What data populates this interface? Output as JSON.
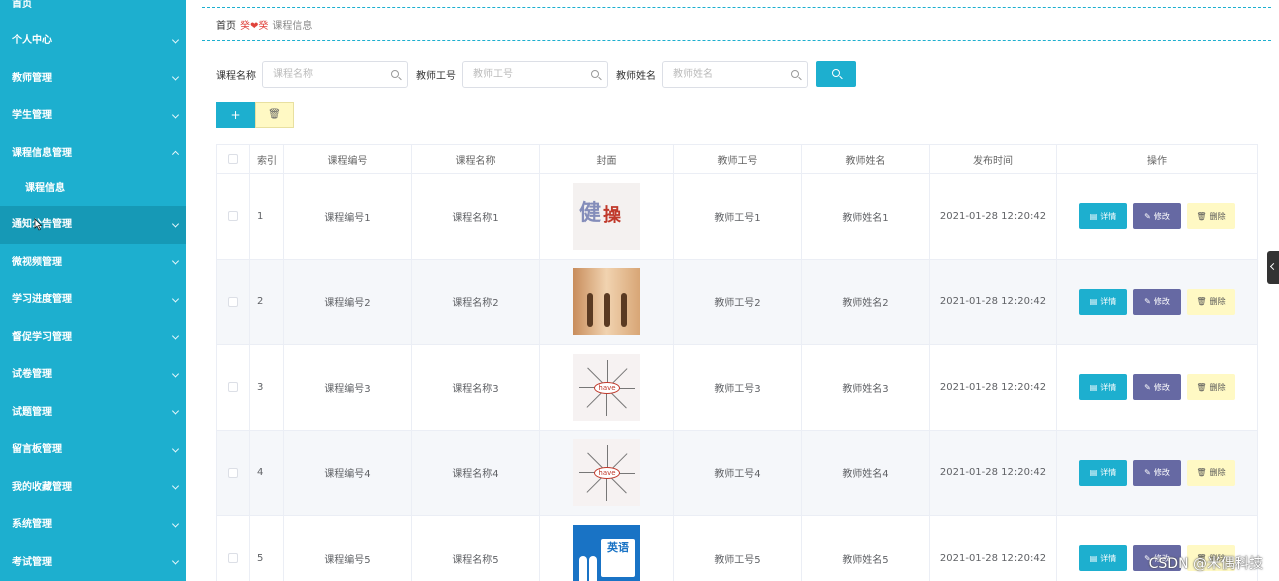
{
  "sidebar": {
    "items": [
      {
        "label": "首页"
      },
      {
        "label": "个人中心"
      },
      {
        "label": "教师管理"
      },
      {
        "label": "学生管理"
      },
      {
        "label": "课程信息管理"
      },
      {
        "label": "课程信息"
      },
      {
        "label": "通知公告管理"
      },
      {
        "label": "微视频管理"
      },
      {
        "label": "学习进度管理"
      },
      {
        "label": "督促学习管理"
      },
      {
        "label": "试卷管理"
      },
      {
        "label": "试题管理"
      },
      {
        "label": "留言板管理"
      },
      {
        "label": "我的收藏管理"
      },
      {
        "label": "系统管理"
      },
      {
        "label": "考试管理"
      }
    ]
  },
  "breadcrumb": {
    "home": "首页",
    "separator": "癸❤癸",
    "current": "课程信息"
  },
  "search": {
    "course_name_label": "课程名称",
    "course_name_placeholder": "课程名称",
    "teacher_no_label": "教师工号",
    "teacher_no_placeholder": "教师工号",
    "teacher_name_label": "教师姓名",
    "teacher_name_placeholder": "教师姓名"
  },
  "actions": {
    "add": "+",
    "delete": "🗑"
  },
  "table": {
    "headers": [
      "索引",
      "课程编号",
      "课程名称",
      "封面",
      "教师工号",
      "教师姓名",
      "发布时间",
      "操作"
    ],
    "rows": [
      {
        "idx": "1",
        "code": "课程编号1",
        "name": "课程名称1",
        "tno": "教师工号1",
        "tname": "教师姓名1",
        "time": "2021-01-28 12:20:42"
      },
      {
        "idx": "2",
        "code": "课程编号2",
        "name": "课程名称2",
        "tno": "教师工号2",
        "tname": "教师姓名2",
        "time": "2021-01-28 12:20:42"
      },
      {
        "idx": "3",
        "code": "课程编号3",
        "name": "课程名称3",
        "tno": "教师工号3",
        "tname": "教师姓名3",
        "time": "2021-01-28 12:20:42"
      },
      {
        "idx": "4",
        "code": "课程编号4",
        "name": "课程名称4",
        "tno": "教师工号4",
        "tname": "教师姓名4",
        "time": "2021-01-28 12:20:42"
      },
      {
        "idx": "5",
        "code": "课程编号5",
        "name": "课程名称5",
        "tno": "教师工号5",
        "tname": "教师姓名5",
        "time": "2021-01-28 12:20:42"
      }
    ],
    "op": {
      "detail": "详情",
      "edit": "修改",
      "delete": "删除"
    }
  },
  "covers": {
    "c1_text": "健",
    "c1_text2": "操",
    "c3_word": "have",
    "c5_text": "英语"
  },
  "watermark": "CSDN @米偶科技",
  "colors": {
    "sidebar": "#1dafcf",
    "active": "#1699b6",
    "edit": "#6669a3",
    "delete": "#fff9c4"
  }
}
